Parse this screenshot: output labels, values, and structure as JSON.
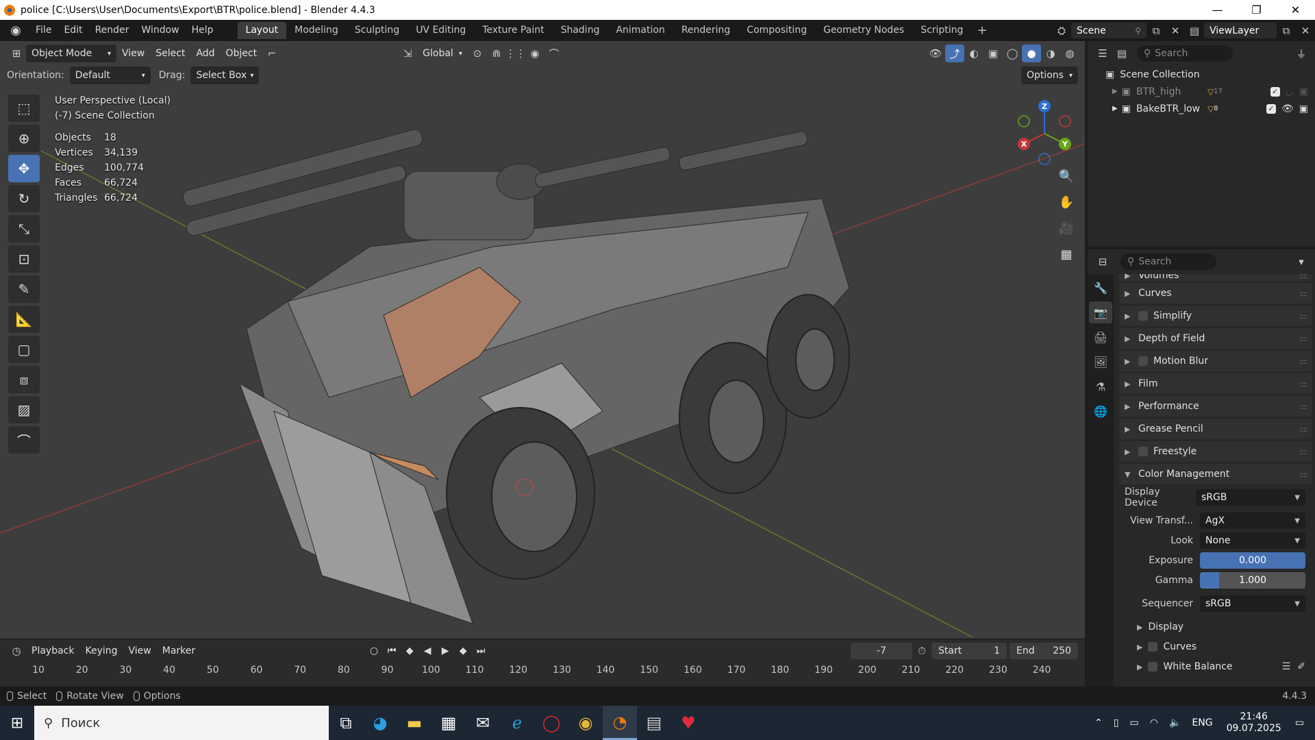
{
  "window": {
    "title": "police [C:\\Users\\User\\Documents\\Export\\BTR\\police.blend] - Blender 4.4.3",
    "min": "—",
    "max": "❐",
    "close": "✕"
  },
  "menu": [
    "File",
    "Edit",
    "Render",
    "Window",
    "Help"
  ],
  "workspaces": [
    "Layout",
    "Modeling",
    "Sculpting",
    "UV Editing",
    "Texture Paint",
    "Shading",
    "Animation",
    "Rendering",
    "Compositing",
    "Geometry Nodes",
    "Scripting"
  ],
  "active_workspace": "Layout",
  "scene": "Scene",
  "view_layer": "ViewLayer",
  "viewport": {
    "mode": "Object Mode",
    "menus": [
      "View",
      "Select",
      "Add",
      "Object"
    ],
    "transform_orientation": "Global",
    "orientation_label": "Orientation:",
    "orientation_value": "Default",
    "drag_label": "Drag:",
    "drag_value": "Select Box",
    "options": "Options",
    "view_name": "User Perspective (Local)",
    "collection": "(-7) Scene Collection",
    "stats": [
      {
        "k": "Objects",
        "v": "18"
      },
      {
        "k": "Vertices",
        "v": "34,139"
      },
      {
        "k": "Edges",
        "v": "100,774"
      },
      {
        "k": "Faces",
        "v": "66,724"
      },
      {
        "k": "Triangles",
        "v": "66,724"
      }
    ],
    "gizmo": {
      "z": "Z",
      "y": "Y",
      "x": "X"
    }
  },
  "outliner": {
    "search_placeholder": "Search",
    "root": "Scene Collection",
    "items": [
      {
        "name": "BTR_high",
        "count": "17"
      },
      {
        "name": "BakeBTR_low",
        "count": "8"
      }
    ]
  },
  "properties": {
    "search_placeholder": "Search",
    "panels_top": [
      "Volumes",
      "Curves",
      "Simplify",
      "Depth of Field",
      "Motion Blur",
      "Film",
      "Performance",
      "Grease Pencil",
      "Freestyle"
    ],
    "color_management": {
      "title": "Color Management",
      "display_device_label": "Display Device",
      "display_device": "sRGB",
      "view_transform_label": "View Transf...",
      "view_transform": "AgX",
      "look_label": "Look",
      "look": "None",
      "exposure_label": "Exposure",
      "exposure": "0.000",
      "exposure_fill": 1.0,
      "gamma_label": "Gamma",
      "gamma": "1.000",
      "gamma_fill": 0.18,
      "sequencer_label": "Sequencer",
      "sequencer": "sRGB",
      "sub": [
        "Display",
        "Curves",
        "White Balance"
      ]
    }
  },
  "timeline": {
    "menus": [
      "Playback",
      "Keying",
      "View",
      "Marker"
    ],
    "current_frame": "-7",
    "start_label": "Start",
    "start": "1",
    "end_label": "End",
    "end": "250",
    "ruler": [
      "10",
      "20",
      "30",
      "40",
      "50",
      "60",
      "70",
      "80",
      "90",
      "100",
      "110",
      "120",
      "130",
      "140",
      "150",
      "160",
      "170",
      "180",
      "190",
      "200",
      "210",
      "220",
      "230",
      "240"
    ]
  },
  "statusbar": {
    "select": "Select",
    "rotate": "Rotate View",
    "options": "Options",
    "version": "4.4.3"
  },
  "taskbar": {
    "search": "Поиск",
    "lang": "ENG",
    "time": "21:46",
    "date": "09.07.2025"
  }
}
